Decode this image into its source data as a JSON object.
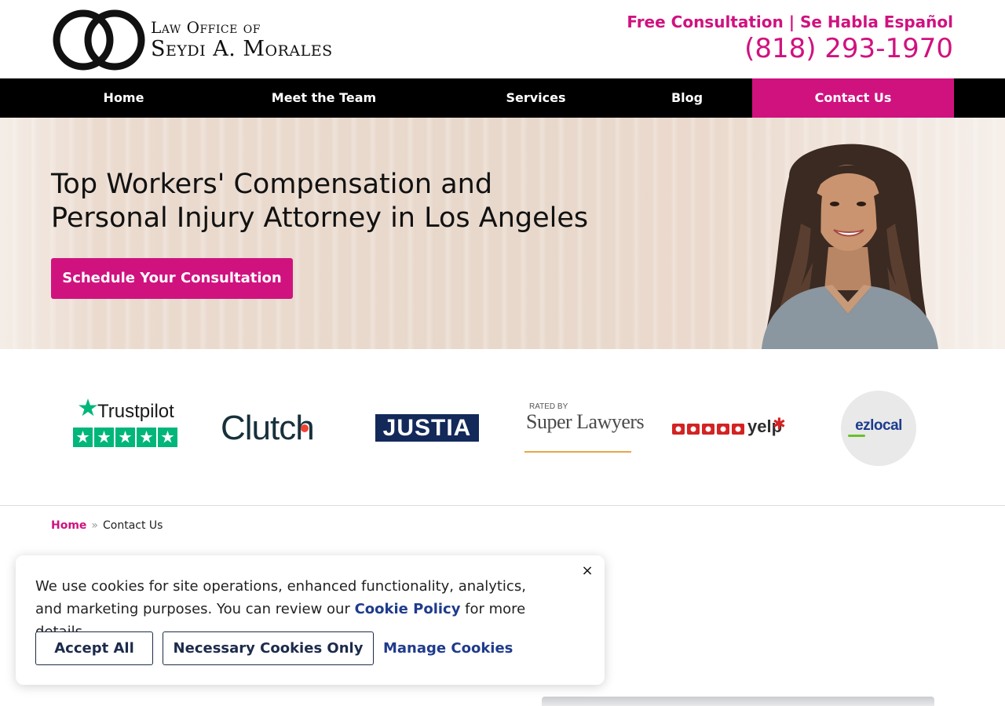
{
  "header": {
    "logo_line1": "Law Office of",
    "logo_line2": "Seydi A. Morales",
    "tagline": "Free Consultation | Se Habla Español",
    "phone": "(818) 293-1970"
  },
  "nav": {
    "items": [
      {
        "label": "Home"
      },
      {
        "label": "Meet the Team"
      },
      {
        "label": "Services"
      },
      {
        "label": "Blog"
      },
      {
        "label": "Contact Us"
      }
    ]
  },
  "hero": {
    "title": "Top Workers' Compensation and Personal Injury Attorney in Los Angeles",
    "cta": "Schedule Your Consultation"
  },
  "badges": {
    "trustpilot": "Trustpilot",
    "clutch": "Clutch",
    "justia": "JUSTIA",
    "superlawyers_rated": "RATED BY",
    "superlawyers": "Super Lawyers",
    "yelp": "yelp",
    "ezlocal": "ezlocal"
  },
  "breadcrumb": {
    "home": "Home",
    "separator": "»",
    "current": "Contact Us"
  },
  "cookie": {
    "text_before": "We use cookies for site operations, enhanced functionality, analytics, and marketing purposes. You can review our ",
    "link": "Cookie Policy",
    "text_after": " for more details.",
    "close": "×",
    "accept": "Accept All",
    "necessary": "Necessary Cookies Only",
    "manage": "Manage Cookies"
  },
  "colors": {
    "brand": "#d0127f",
    "nav_bg": "#000000",
    "cookie_link": "#1f3b8c"
  }
}
